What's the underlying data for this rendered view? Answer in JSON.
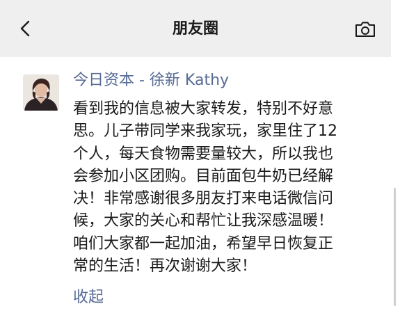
{
  "nav": {
    "title": "朋友圈",
    "back_icon": "chevron-left-icon",
    "camera_icon": "camera-icon"
  },
  "post": {
    "author": "今日资本 - 徐新 Kathy",
    "content_lines": [
      "看到我的信息被大家转发，特别不好意",
      "思。儿子带同学来我家玩，家里住了12",
      "个人，每天食物需要量较大，所以我也",
      "会参加小区团购。目前面包牛奶已经解",
      "决！非常感谢很多朋友打来电话微信问",
      "候，大家的关心和帮忙让我深感温暖！",
      "咱们大家都一起加油，希望早日恢复正",
      "常的生活！再次谢谢大家！"
    ],
    "collapse_label": "收起"
  },
  "colors": {
    "nav_background": "#efefef",
    "link": "#576b95",
    "text": "#1a1a1a"
  }
}
